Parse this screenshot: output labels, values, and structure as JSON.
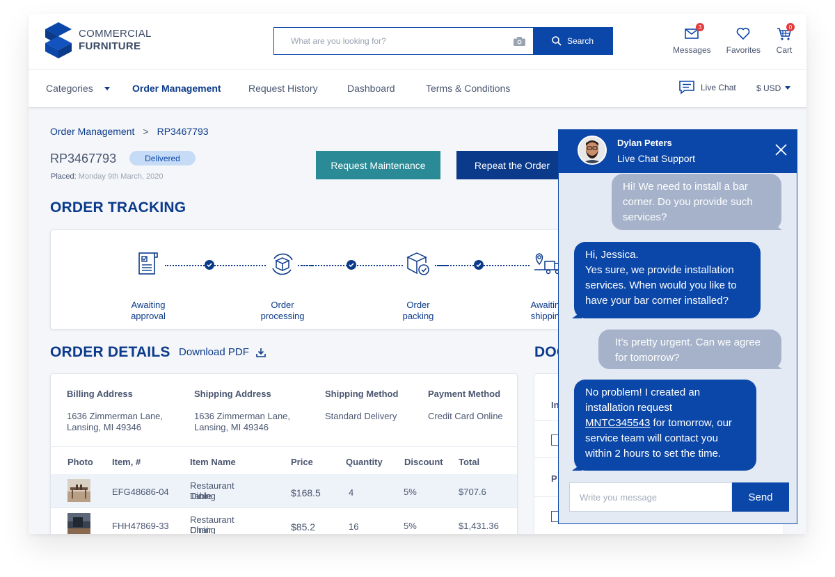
{
  "brand": {
    "line1": "COMMERCIAL",
    "line2": "FURNITURE"
  },
  "search": {
    "placeholder": "What are you looking for?",
    "button_label": "Search"
  },
  "header_icons": {
    "messages": {
      "label": "Messages",
      "count": "3"
    },
    "favorites": {
      "label": "Favorites"
    },
    "cart": {
      "label": "Cart",
      "count": "0"
    }
  },
  "nav": {
    "categories": "Categories",
    "items": [
      "Order Management",
      "Request History",
      "Dashboard",
      "Terms & Conditions"
    ],
    "live_chat": "Live Chat",
    "currency": "$ USD"
  },
  "breadcrumb": {
    "parent": "Order Management",
    "current": "RP3467793"
  },
  "order": {
    "id": "RP3467793",
    "status": "Delivered",
    "placed_label": "Placed:",
    "placed_date": "Monday 9th March, 2020"
  },
  "actions": {
    "maintenance": "Request Maintenance",
    "repeat": "Repeat the Order"
  },
  "tracking": {
    "title": "ORDER TRACKING",
    "steps": [
      {
        "line1": "Awaiting",
        "line2": "approval"
      },
      {
        "line1": "Order",
        "line2": "processing"
      },
      {
        "line1": "Order",
        "line2": "packing"
      },
      {
        "line1": "Awaiting",
        "line2": "shipping"
      }
    ]
  },
  "details": {
    "title": "ORDER DETAILS",
    "download": "Download PDF",
    "billing": {
      "heading": "Billing Address",
      "line1": "1636  Zimmerman Lane,",
      "line2": "Lansing, MI 49346"
    },
    "shipping": {
      "heading": "Shipping Address",
      "line1": "1636  Zimmerman Lane,",
      "line2": "Lansing, MI 49346"
    },
    "method": {
      "heading": "Shipping Method",
      "value": "Standard Delivery"
    },
    "payment": {
      "heading": "Payment Method",
      "value": "Credit Card Online"
    },
    "columns": [
      "Photo",
      "Item, #",
      "Item Name",
      "Price",
      "Quantity",
      "Discount",
      "Total"
    ],
    "rows": [
      {
        "item": "EFG48686-04",
        "name1": "Restaurant Dining",
        "name2": "Table",
        "price": "$168.5",
        "qty": "4",
        "discount": "5%",
        "total": "$707.6"
      },
      {
        "item": "FHH47869-33",
        "name1": "Restaurant Dining",
        "name2": "Chair",
        "price": "$85.2",
        "qty": "16",
        "discount": "5%",
        "total": "$1,431.36"
      }
    ]
  },
  "documents": {
    "title": "DOC",
    "row1": "In",
    "row2": "P"
  },
  "chat": {
    "agent_name": "Dylan Peters",
    "agent_role": "Live Chat Support",
    "messages": [
      {
        "from": "user",
        "lines": [
          "Hi! We need to install a bar",
          "corner. Do you provide such",
          "services?"
        ]
      },
      {
        "from": "agent",
        "lines": [
          "Hi, Jessica.",
          "Yes sure, we provide installation",
          "services. When would you like to",
          "have your bar corner installed?"
        ]
      },
      {
        "from": "user",
        "lines": [
          "It’s pretty urgent. Can we agree",
          "for tomorrow?"
        ]
      },
      {
        "from": "agent",
        "l1": "No problem! I created an",
        "l2": "installation request",
        "link": "MNTC345543",
        "l3rest": " for tomorrow, our",
        "l4": "service team will contact you",
        "l5": "within 2 hours to set the time."
      }
    ],
    "input_placeholder": "Write you message",
    "send_label": "Send"
  }
}
